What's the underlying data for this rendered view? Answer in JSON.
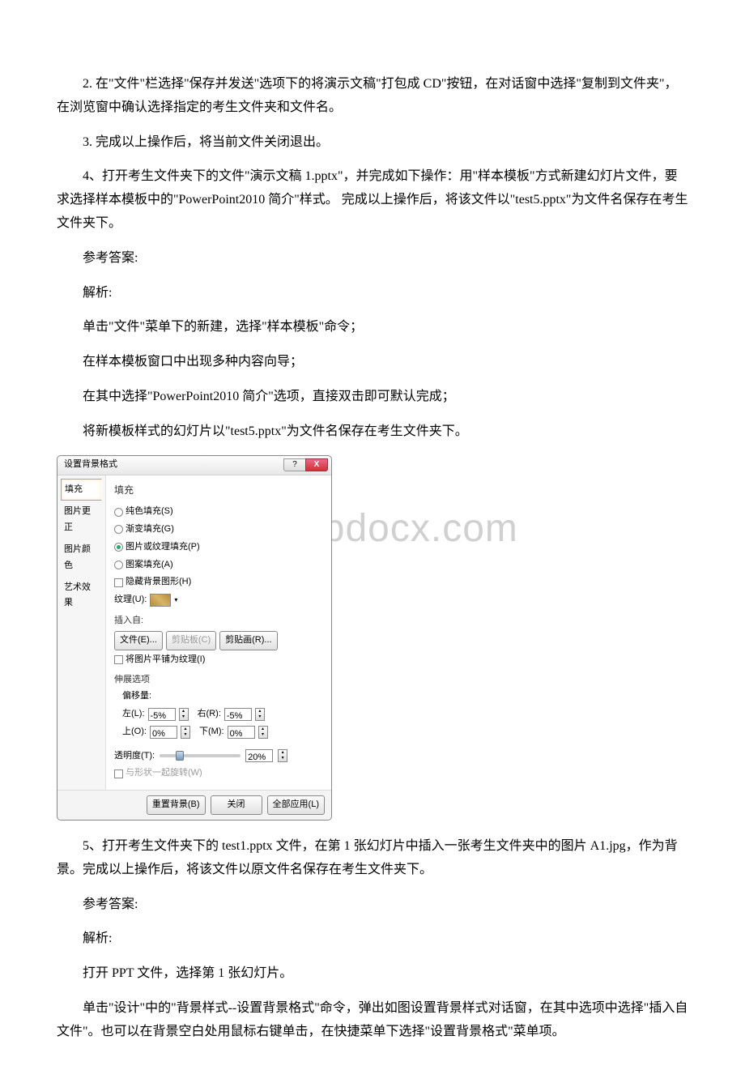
{
  "watermark_text": "www.bdocx.com",
  "paragraphs": {
    "p1": "2. 在\"文件\"栏选择\"保存并发送\"选项下的将演示文稿\"打包成 CD\"按钮，在对话窗中选择\"复制到文件夹\"，在浏览窗中确认选择指定的考生文件夹和文件名。",
    "p2": "3. 完成以上操作后，将当前文件关闭退出。",
    "p3": "4、打开考生文件夹下的文件\"演示文稿 1.pptx\"，并完成如下操作：用\"样本模板\"方式新建幻灯片文件，要求选择样本模板中的\"PowerPoint2010 简介\"样式。 完成以上操作后，将该文件以\"test5.pptx\"为文件名保存在考生文件夹下。",
    "p4": "参考答案:",
    "p5": "解析:",
    "p6": "单击\"文件\"菜单下的新建，选择\"样本模板\"命令；",
    "p7": "在样本模板窗口中出现多种内容向导；",
    "p8": "在其中选择\"PowerPoint2010 简介\"选项，直接双击即可默认完成；",
    "p9": "将新模板样式的幻灯片以\"test5.pptx\"为文件名保存在考生文件夹下。",
    "p10": "5、打开考生文件夹下的 test1.pptx 文件，在第 1 张幻灯片中插入一张考生文件夹中的图片 A1.jpg，作为背景。完成以上操作后，将该文件以原文件名保存在考生文件夹下。",
    "p11": "参考答案:",
    "p12": "解析:",
    "p13": "打开 PPT 文件，选择第 1 张幻灯片。",
    "p14": "单击\"设计\"中的\"背景样式--设置背景格式\"命令，弹出如图设置背景样式对话窗，在其中选项中选择\"插入自文件\"。也可以在背景空白处用鼠标右键单击，在快捷菜单下选择\"设置背景格式\"菜单项。"
  },
  "dialog": {
    "title": "设置背景格式",
    "help_icon": "?",
    "close_icon": "X",
    "sidebar": {
      "items": [
        "填充",
        "图片更正",
        "图片颜色",
        "艺术效果"
      ],
      "selected_index": 0
    },
    "panel": {
      "heading": "填充",
      "radio_solid": "纯色填充(S)",
      "radio_gradient": "渐变填充(G)",
      "radio_picture": "图片或纹理填充(P)",
      "radio_pattern": "图案填充(A)",
      "chk_hide_bg": "隐藏背景图形(H)",
      "texture_label": "纹理(U):",
      "insert_from": "插入自:",
      "btn_file": "文件(E)...",
      "btn_clipboard": "剪贴板(C)",
      "btn_clipart": "剪贴画(R)...",
      "chk_tile": "将图片平铺为纹理(I)",
      "stretch_section": "伸展选项",
      "offset_label": "偏移量:",
      "offset_left_lbl": "左(L):",
      "offset_left_val": "-5%",
      "offset_right_lbl": "右(R):",
      "offset_right_val": "-5%",
      "offset_top_lbl": "上(O):",
      "offset_top_val": "0%",
      "offset_bottom_lbl": "下(M):",
      "offset_bottom_val": "0%",
      "transparency_lbl": "透明度(T):",
      "transparency_val": "20%",
      "chk_rotate": "与形状一起旋转(W)"
    },
    "footer": {
      "reset": "重置背景(B)",
      "close": "关闭",
      "apply_all": "全部应用(L)"
    }
  }
}
